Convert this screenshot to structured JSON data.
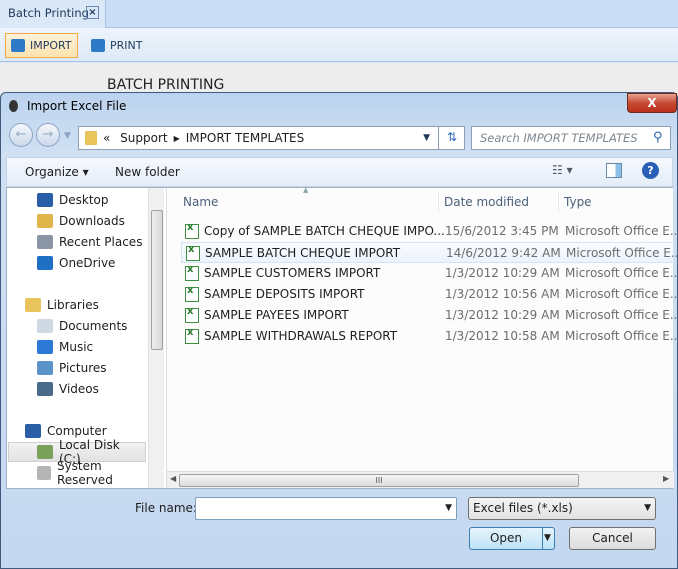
{
  "app": {
    "tab_label": "Batch Printing",
    "tab_close": "×",
    "toolbar": {
      "import_label": "IMPORT",
      "print_label": "PRINT"
    },
    "page_title": "BATCH PRINTING"
  },
  "dialog": {
    "title": "Import Excel File",
    "close_label": "X",
    "address": {
      "prefix": "«",
      "crumbs": [
        "Support",
        "IMPORT TEMPLATES"
      ]
    },
    "search_placeholder": "Search IMPORT TEMPLATES",
    "commands": {
      "organize": "Organize ▾",
      "new_folder": "New folder"
    },
    "nav": [
      {
        "label": "Desktop",
        "icon": "desktop-icon",
        "color": "#2a5fa8"
      },
      {
        "label": "Downloads",
        "icon": "downloads-folder-icon",
        "color": "#e0b64a"
      },
      {
        "label": "Recent Places",
        "icon": "recent-places-icon",
        "color": "#8a96a6"
      },
      {
        "label": "OneDrive",
        "icon": "onedrive-icon",
        "color": "#1f6fc4"
      },
      {
        "label": "Libraries",
        "icon": "libraries-icon",
        "color": "#e8c45a"
      },
      {
        "label": "Documents",
        "icon": "documents-icon",
        "color": "#cfd8e3"
      },
      {
        "label": "Music",
        "icon": "music-icon",
        "color": "#2c7ad6"
      },
      {
        "label": "Pictures",
        "icon": "pictures-icon",
        "color": "#5b93c9"
      },
      {
        "label": "Videos",
        "icon": "videos-icon",
        "color": "#4a6a8a"
      },
      {
        "label": "Computer",
        "icon": "computer-icon",
        "color": "#2a5fa8"
      },
      {
        "label": "Local Disk (C:)",
        "icon": "local-disk-icon",
        "color": "#7aa05a",
        "selected": true
      },
      {
        "label": "System Reserved",
        "icon": "drive-icon",
        "color": "#b5b5b5"
      }
    ],
    "columns": [
      "Name",
      "Date modified",
      "Type"
    ],
    "files": [
      {
        "name": "Copy of SAMPLE BATCH CHEQUE IMPO...",
        "date": "15/6/2012 3:45 PM",
        "type": "Microsoft Office E..."
      },
      {
        "name": "SAMPLE BATCH CHEQUE IMPORT",
        "date": "14/6/2012 9:42 AM",
        "type": "Microsoft Office E...",
        "selected": true
      },
      {
        "name": "SAMPLE CUSTOMERS IMPORT",
        "date": "1/3/2012 10:29 AM",
        "type": "Microsoft Office E..."
      },
      {
        "name": "SAMPLE DEPOSITS IMPORT",
        "date": "1/3/2012 10:56 AM",
        "type": "Microsoft Office E..."
      },
      {
        "name": "SAMPLE PAYEES IMPORT",
        "date": "1/3/2012 10:29 AM",
        "type": "Microsoft Office E..."
      },
      {
        "name": "SAMPLE WITHDRAWALS REPORT",
        "date": "1/3/2012 10:58 AM",
        "type": "Microsoft Office E..."
      }
    ],
    "file_name_label": "File name:",
    "file_name_value": "",
    "filter_value": "Excel files (*.xls)",
    "open_label": "Open",
    "cancel_label": "Cancel"
  }
}
